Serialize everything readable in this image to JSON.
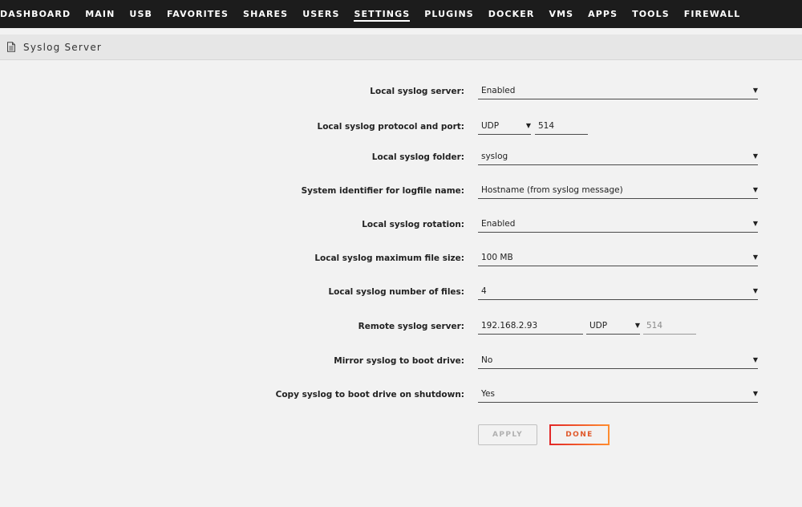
{
  "nav": {
    "items": [
      "DASHBOARD",
      "MAIN",
      "USB",
      "FAVORITES",
      "SHARES",
      "USERS",
      "SETTINGS",
      "PLUGINS",
      "DOCKER",
      "VMS",
      "APPS",
      "TOOLS",
      "FIREWALL"
    ],
    "active": "SETTINGS"
  },
  "page": {
    "title": "Syslog Server"
  },
  "form": {
    "local_server": {
      "label": "Local syslog server:",
      "value": "Enabled"
    },
    "protocol_port": {
      "label": "Local syslog protocol and port:",
      "protocol": "UDP",
      "port": "514"
    },
    "folder": {
      "label": "Local syslog folder:",
      "value": "syslog"
    },
    "identifier": {
      "label": "System identifier for logfile name:",
      "value": "Hostname (from syslog message)"
    },
    "rotation": {
      "label": "Local syslog rotation:",
      "value": "Enabled"
    },
    "max_size": {
      "label": "Local syslog maximum file size:",
      "value": "100 MB"
    },
    "num_files": {
      "label": "Local syslog number of files:",
      "value": "4"
    },
    "remote": {
      "label": "Remote syslog server:",
      "host": "192.168.2.93",
      "protocol": "UDP",
      "port": "514"
    },
    "mirror": {
      "label": "Mirror syslog to boot drive:",
      "value": "No"
    },
    "copy": {
      "label": "Copy syslog to boot drive on shutdown:",
      "value": "Yes"
    }
  },
  "buttons": {
    "apply": "APPLY",
    "done": "DONE"
  },
  "colors": {
    "nav_bg": "#1c1c1c",
    "page_bg": "#f2f2f2",
    "accent_start": "#e22828",
    "accent_end": "#ff8c2f"
  }
}
